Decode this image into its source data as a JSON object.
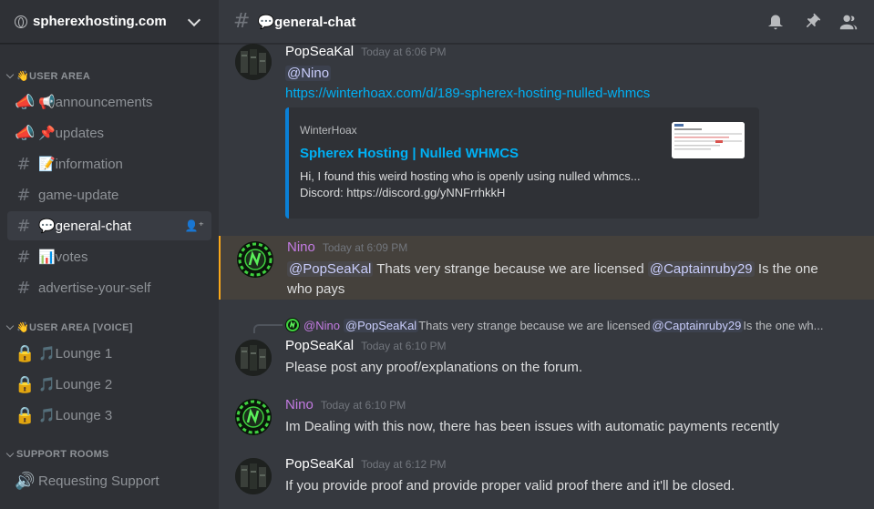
{
  "server": {
    "name": "spherexhosting.com"
  },
  "sidebar": {
    "categories": [
      {
        "label": "👋USER AREA"
      },
      {
        "label": "👋USER AREA [VOICE]"
      },
      {
        "label": "SUPPORT ROOMS"
      }
    ],
    "channels": [
      {
        "label": "📢announcements",
        "icon": "megaphone-icon"
      },
      {
        "label": "📌updates",
        "icon": "megaphone-icon"
      },
      {
        "label": "📝information",
        "icon": "hash-icon"
      },
      {
        "label": "game-update",
        "icon": "hash-icon"
      },
      {
        "label": "💬general-chat",
        "icon": "hash-icon"
      },
      {
        "label": "📊votes",
        "icon": "hash-icon"
      },
      {
        "label": "advertise-your-self",
        "icon": "hash-icon"
      }
    ],
    "voice": [
      {
        "label": "🎵Lounge 1",
        "icon": "lock-icon"
      },
      {
        "label": "🎵Lounge 2",
        "icon": "lock-icon"
      },
      {
        "label": "🎵Lounge 3",
        "icon": "lock-icon"
      }
    ],
    "support": [
      {
        "label": "Requesting Support",
        "icon": "speaker-icon"
      }
    ]
  },
  "topbar": {
    "title": "💬general-chat"
  },
  "messages": [
    {
      "user": "PopSeaKal",
      "time": "Today at 6:06 PM",
      "mention": "@Nino",
      "link": "https://winterhoax.com/d/189-spherex-hosting-nulled-whmcs",
      "embed": {
        "provider": "WinterHoax",
        "title": "Spherex Hosting | Nulled WHMCS",
        "desc1": "Hi, I found this weird hosting who is openly using nulled whmcs...",
        "desc2": "Discord: https://discord.gg/yNNFrrhkkH"
      }
    },
    {
      "user": "Nino",
      "time": "Today at 6:09 PM",
      "mention1": "@PopSeaKal",
      "text1": " Thats very strange because we are licensed ",
      "mention2": "@Captainruby29",
      "text2": " Is the one",
      "text3": "who pays"
    },
    {
      "reply": {
        "user": "@Nino",
        "mention1": "@PopSeaKal",
        "text1": " Thats very strange because we are licensed ",
        "mention2": "@Captainruby29",
        "text2": " Is the one wh..."
      },
      "user": "PopSeaKal",
      "time": "Today at 6:10 PM",
      "text": "Please post any proof/explanations on the forum."
    },
    {
      "user": "Nino",
      "time": "Today at 6:10 PM",
      "text": "Im Dealing with this now, there has been issues with automatic payments recently"
    },
    {
      "user": "PopSeaKal",
      "time": "Today at 6:12 PM",
      "text": "If you provide proof and provide proper valid proof there and it'll be closed."
    }
  ]
}
